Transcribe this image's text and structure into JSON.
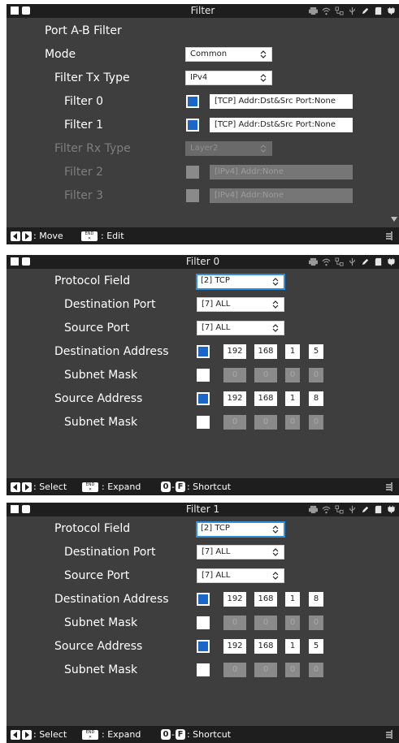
{
  "colors": {
    "panel_bg": "#3e3e3e",
    "bar_bg": "#1e1e1e",
    "accent_blue": "#1b66c9",
    "focus_border": "#2f8fdc"
  },
  "status_icons": [
    "printer-icon",
    "wifi-icon",
    "network-icon",
    "usb-icon",
    "edit-icon",
    "sd-card-icon",
    "battery-plug-icon"
  ],
  "screen1": {
    "title": "Filter",
    "heading": "Port A-B Filter",
    "mode": {
      "label": "Mode",
      "value": "Common"
    },
    "filter_tx_type": {
      "label": "Filter Tx Type",
      "value": "IPv4"
    },
    "filter0": {
      "label": "Filter 0",
      "checked": true,
      "value": "[TCP] Addr:Dst&Src  Port:None"
    },
    "filter1": {
      "label": "Filter 1",
      "checked": true,
      "value": "[TCP] Addr:Dst&Src  Port:None"
    },
    "filter_rx_type": {
      "label": "Filter Rx Type",
      "value": "Layer2"
    },
    "filter2": {
      "label": "Filter 2",
      "checked": false,
      "value": "[IPv4] Addr:None"
    },
    "filter3": {
      "label": "Filter 3",
      "checked": false,
      "value": "[IPv4] Addr:None"
    },
    "hints": {
      "move": ": Move",
      "edit": ": Edit",
      "end_key": "END\n✕"
    }
  },
  "screen2": {
    "title": "Filter 0",
    "protocol_field": {
      "label": "Protocol Field",
      "value": "[2] TCP"
    },
    "destination_port": {
      "label": "Destination Port",
      "value": "[7] ALL"
    },
    "source_port": {
      "label": "Source Port",
      "value": "[7] ALL"
    },
    "destination_address": {
      "label": "Destination Address",
      "checked": true,
      "octets": [
        "192",
        "168",
        "1",
        "5"
      ]
    },
    "dst_subnet_mask": {
      "label": "Subnet Mask",
      "checked": false,
      "octets": [
        "0",
        "0",
        "0",
        "0"
      ]
    },
    "source_address": {
      "label": "Source Address",
      "checked": true,
      "octets": [
        "192",
        "168",
        "1",
        "8"
      ]
    },
    "src_subnet_mask": {
      "label": "Subnet Mask",
      "checked": false,
      "octets": [
        "0",
        "0",
        "0",
        "0"
      ]
    },
    "hints": {
      "select": ": Select",
      "expand": ": Expand",
      "shortcut": ": Shortcut",
      "key0": "0",
      "keyF": "F",
      "dash": "-"
    }
  },
  "screen3": {
    "title": "Filter 1",
    "protocol_field": {
      "label": "Protocol Field",
      "value": "[2] TCP"
    },
    "destination_port": {
      "label": "Destination Port",
      "value": "[7] ALL"
    },
    "source_port": {
      "label": "Source Port",
      "value": "[7] ALL"
    },
    "destination_address": {
      "label": "Destination Address",
      "checked": true,
      "octets": [
        "192",
        "168",
        "1",
        "8"
      ]
    },
    "dst_subnet_mask": {
      "label": "Subnet Mask",
      "checked": false,
      "octets": [
        "0",
        "0",
        "0",
        "0"
      ]
    },
    "source_address": {
      "label": "Source Address",
      "checked": true,
      "octets": [
        "192",
        "168",
        "1",
        "5"
      ]
    },
    "src_subnet_mask": {
      "label": "Subnet Mask",
      "checked": false,
      "octets": [
        "0",
        "0",
        "0",
        "0"
      ]
    },
    "hints": {
      "select": ": Select",
      "expand": ": Expand",
      "shortcut": ": Shortcut",
      "key0": "0",
      "keyF": "F",
      "dash": "-"
    }
  }
}
